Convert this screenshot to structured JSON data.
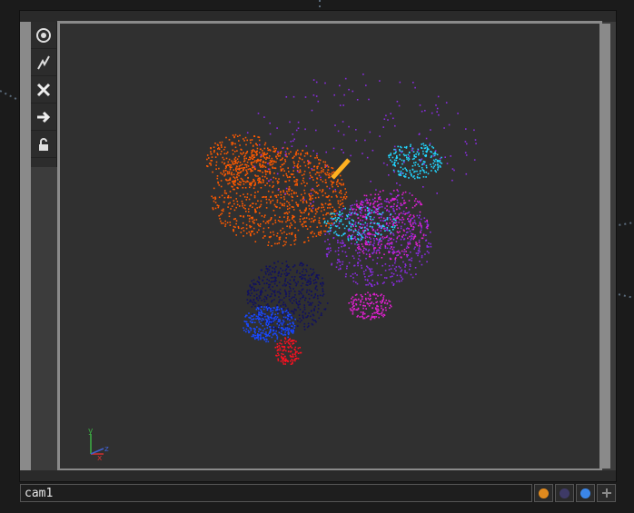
{
  "node": {
    "name": "cam1"
  },
  "toolbar": {
    "tools": [
      {
        "icon": "target-icon"
      },
      {
        "icon": "lightning-icon"
      },
      {
        "icon": "close-icon"
      },
      {
        "icon": "arrow-right-icon"
      },
      {
        "icon": "lock-icon"
      }
    ]
  },
  "gizmo": {
    "y_label": "y",
    "x_label": "x",
    "z_label": "z"
  },
  "flags": [
    {
      "icon": "orange-dot-icon",
      "color": "#e08a1e"
    },
    {
      "icon": "purple-dot-icon",
      "color": "#3e3a66"
    },
    {
      "icon": "blue-dot-icon",
      "color": "#3b86e8"
    },
    {
      "icon": "plus-icon",
      "color": "#7a7a7a"
    }
  ],
  "colors": {
    "orange": "#ff5a00",
    "cyan": "#22d6ff",
    "purple": "#8a2be2",
    "magenta": "#e020d0",
    "blue": "#1848ff",
    "navy": "#101060",
    "red": "#ff1020",
    "yellow": "#ffb020"
  }
}
